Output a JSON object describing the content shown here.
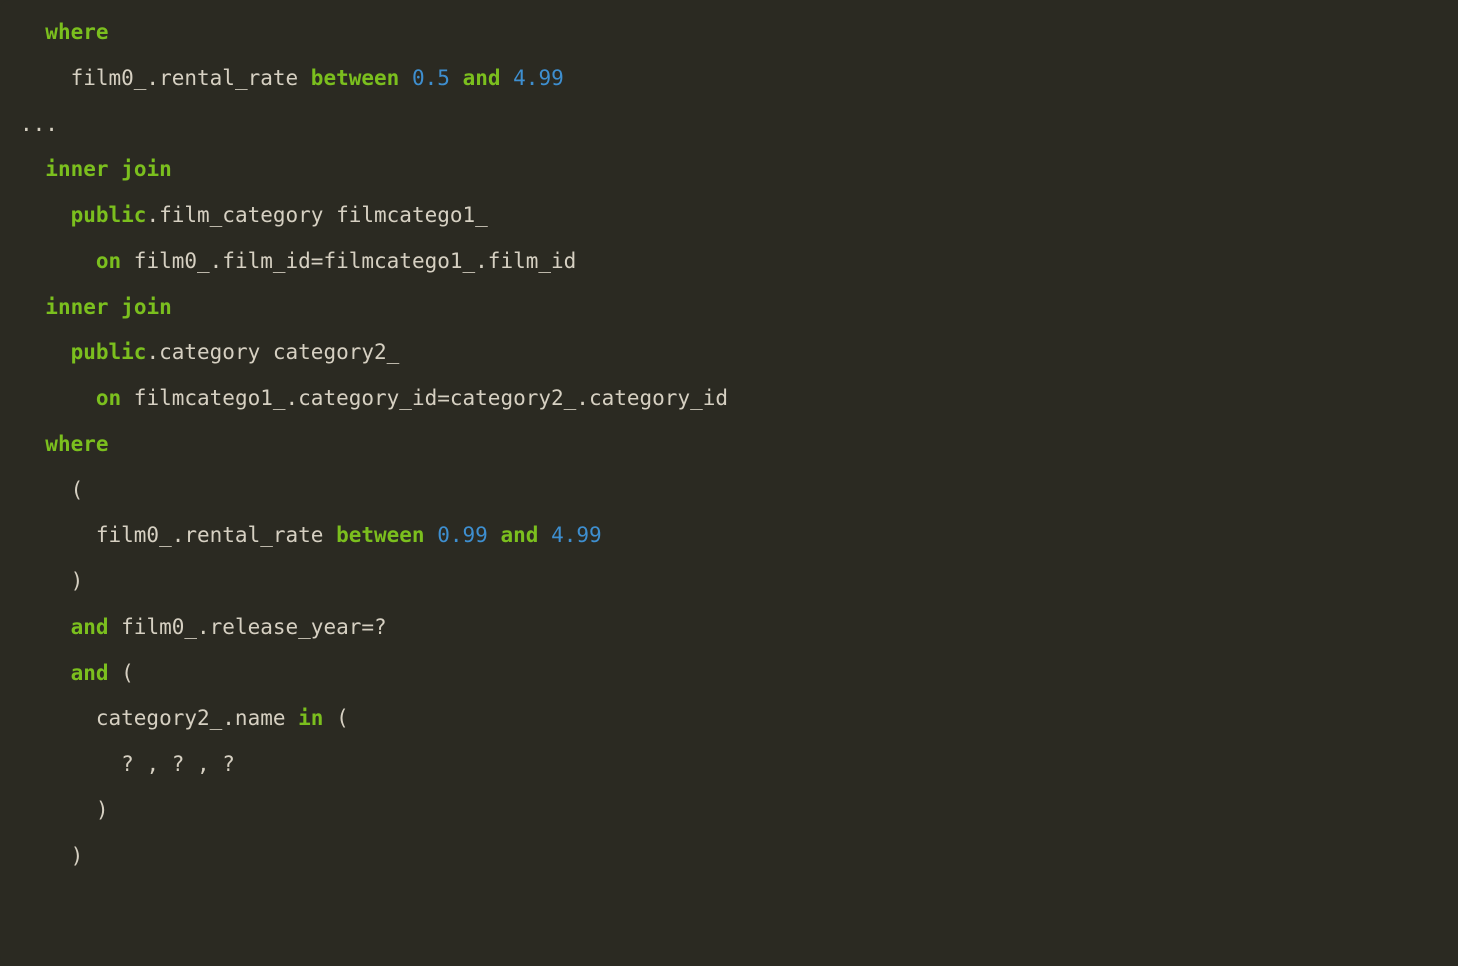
{
  "code": {
    "theme": {
      "background": "#2b2a22",
      "keyword": "#7bbf1e",
      "number": "#3e8fd0",
      "text": "#d6d0c2"
    },
    "tokens": {
      "where1": "where",
      "line2_a": "film0_.rental_rate ",
      "between1": "between",
      "sp1": " ",
      "n05": "0.5",
      "sp2": " ",
      "and1": "and",
      "sp3": " ",
      "n499a": "4.99",
      "ellipsis": "...",
      "inner1": "inner",
      "sp4": " ",
      "join1": "join",
      "public1": "public",
      "dot1": ".film_category filmcatego1_ ",
      "on1": "on",
      "on1rest": " film0_.film_id=filmcatego1_.film_id ",
      "inner2": "inner",
      "sp5": " ",
      "join2": "join",
      "public2": "public",
      "dot2": ".category category2_ ",
      "on2": "on",
      "on2rest": " filmcatego1_.category_id=category2_.category_id ",
      "where2": "where",
      "lpar1": "(",
      "line_rr": "film0_.rental_rate ",
      "between2": "between",
      "sp6": " ",
      "n099": "0.99",
      "sp7": " ",
      "and2": "and",
      "sp8": " ",
      "n499b": "4.99",
      "rpar1": ") ",
      "and3": "and",
      "rel": " film0_.release_year=? ",
      "and4": "and",
      "lpar2": " (",
      "catname": "category2_.name ",
      "in1": "in",
      "lpar3": " (",
      "qmarks": "? , ? , ?",
      "rpar2": ")",
      "rpar3": ")"
    }
  }
}
